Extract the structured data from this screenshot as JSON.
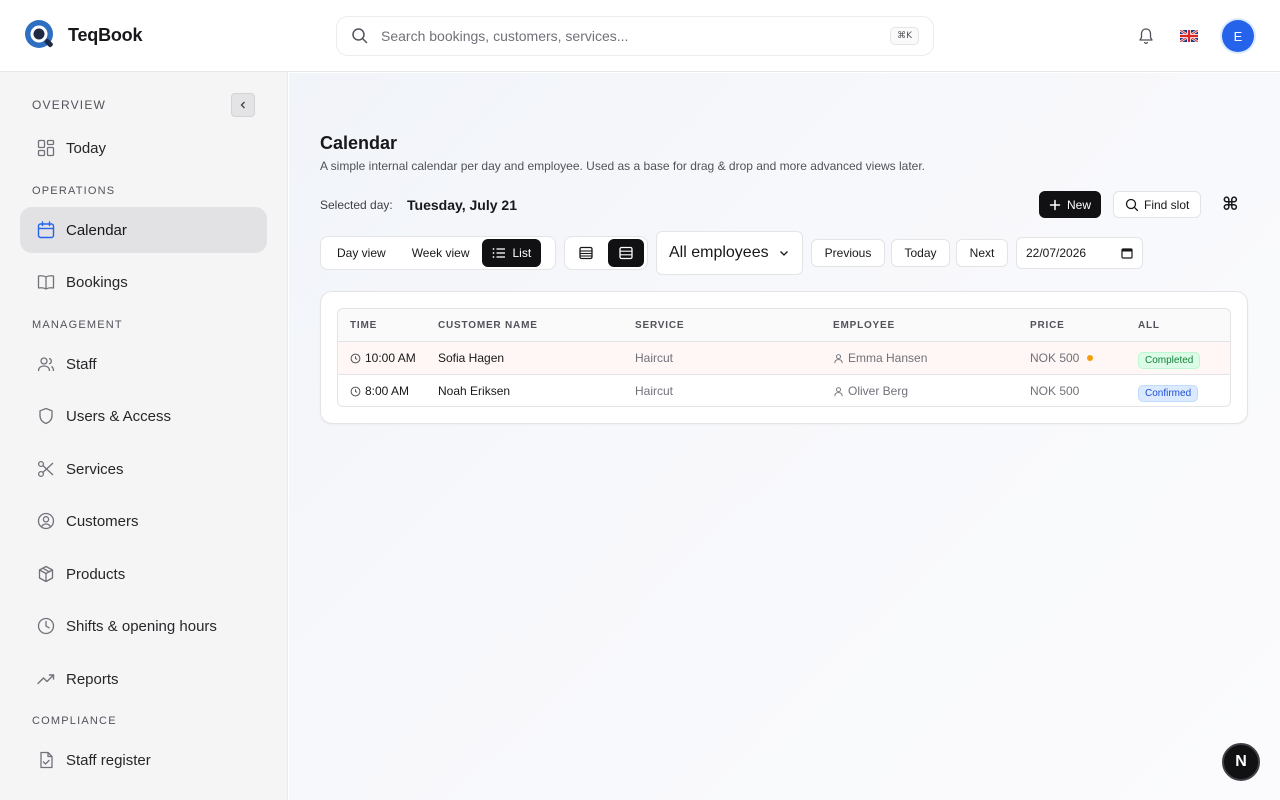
{
  "app": {
    "name": "TeqBook"
  },
  "search": {
    "placeholder": "Search bookings, customers, services...",
    "shortcut": "⌘K"
  },
  "header": {
    "avatar_initial": "E"
  },
  "sidebar": {
    "overview_label": "OVERVIEW",
    "operations_label": "OPERATIONS",
    "management_label": "MANAGEMENT",
    "compliance_label": "COMPLIANCE",
    "items": [
      {
        "label": "Today"
      },
      {
        "label": "Calendar"
      },
      {
        "label": "Bookings"
      },
      {
        "label": "Staff"
      },
      {
        "label": "Users & Access"
      },
      {
        "label": "Services"
      },
      {
        "label": "Customers"
      },
      {
        "label": "Products"
      },
      {
        "label": "Shifts & opening hours"
      },
      {
        "label": "Reports"
      },
      {
        "label": "Staff register"
      }
    ]
  },
  "page": {
    "title": "Calendar",
    "subtitle": "A simple internal calendar per day and employee. Used as a base for drag & drop and more advanced views later.",
    "selected_day_label": "Selected day:",
    "selected_day": "Tuesday, July 21",
    "new_label": "New",
    "find_slot_label": "Find slot",
    "cmd_glyph": "⌘"
  },
  "views": {
    "day": "Day view",
    "week": "Week view",
    "list": "List"
  },
  "filters": {
    "employee": "All employees",
    "previous": "Previous",
    "today": "Today",
    "next": "Next",
    "date": "22/07/2026"
  },
  "table": {
    "headers": [
      "TIME",
      "CUSTOMER NAME",
      "SERVICE",
      "EMPLOYEE",
      "PRICE",
      "ALL"
    ],
    "rows": [
      {
        "time": "10:00 AM",
        "customer": "Sofia Hagen",
        "service": "Haircut",
        "employee": "Emma Hansen",
        "price": "NOK 500",
        "status": "Completed"
      },
      {
        "time": "8:00 AM",
        "customer": "Noah Eriksen",
        "service": "Haircut",
        "employee": "Oliver Berg",
        "price": "NOK 500",
        "status": "Confirmed"
      }
    ]
  },
  "dev_badge": "N",
  "colors": {
    "accent": "#2563eb",
    "primary_button": "#111113",
    "completed": "#15803d",
    "confirmed": "#1d4ed8",
    "pending_dot": "#f59e0b"
  }
}
